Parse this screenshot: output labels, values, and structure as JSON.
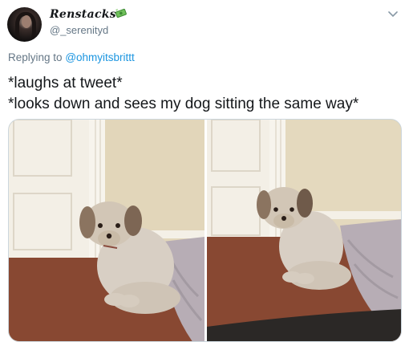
{
  "author": {
    "display_name": "Renstacks",
    "handle": "@_serenityd"
  },
  "reply": {
    "prefix": "Replying to",
    "mention": "@ohmyitsbrittt"
  },
  "tweet": {
    "lines": [
      "*laughs at tweet*",
      "*looks down and sees my dog sitting the same way*"
    ]
  },
  "icons": {
    "badge": "money-with-wings-icon",
    "menu": "chevron-down-icon"
  },
  "colors": {
    "link": "#1b95e0",
    "secondary_text": "#657786"
  }
}
